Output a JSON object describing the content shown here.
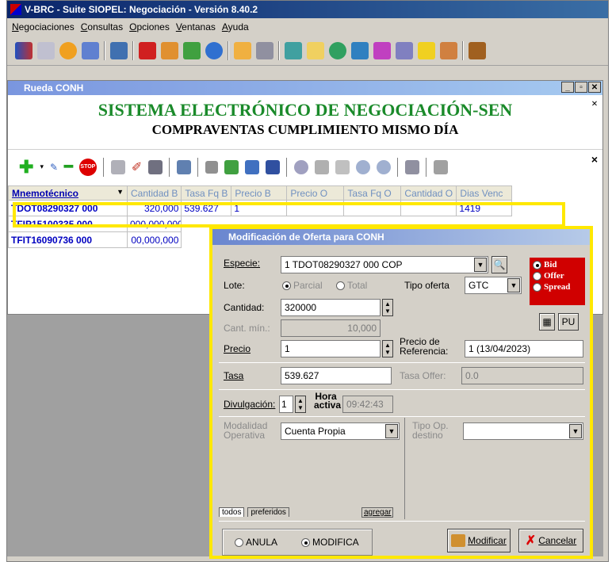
{
  "app": {
    "title": "V-BRC - Suite SIOPEL: Negociación - Versión 8.40.2"
  },
  "menu": [
    "Negociaciones",
    "Consultas",
    "Opciones",
    "Ventanas",
    "Ayuda"
  ],
  "subwindow": {
    "title": "Rueda CONH",
    "banner_line1": "SISTEMA ELECTRÓNICO DE NEGOCIACIÓN-SEN",
    "banner_line2": "COMPRAVENTAS CUMPLIMIENTO MISMO DÍA"
  },
  "grid": {
    "columns": [
      "Mnemotécnico",
      "Cantidad B",
      "Tasa Fq B",
      "Precio B",
      "Precio O",
      "Tasa Fq O",
      "Cantidad O",
      "Dias Venc"
    ],
    "rows": [
      {
        "mnemo": "TDOT08290327 000",
        "cant_b": "320,000",
        "tasa_b": "539.627",
        "precio_b": "1",
        "precio_o": "",
        "tasa_o": "",
        "cant_o": "",
        "dias": "1419"
      },
      {
        "mnemo": "TFIP15100335 000",
        "cant_b": "000,000,000",
        "tasa_b": "",
        "precio_b": "",
        "precio_o": "",
        "tasa_o": "",
        "cant_o": "",
        "dias": ""
      },
      {
        "mnemo": "TFIT16090736 000",
        "cant_b": "00,000,000",
        "tasa_b": "",
        "precio_b": "",
        "precio_o": "",
        "tasa_o": "",
        "cant_o": "",
        "dias": ""
      }
    ]
  },
  "dialog": {
    "title": "Modificación de Oferta para CONH",
    "especie_label": "Especie:",
    "especie_value": "1 TDOT08290327 000 COP",
    "lote_label": "Lote:",
    "lote_parcial": "Parcial",
    "lote_total": "Total",
    "tipo_oferta_label": "Tipo oferta",
    "tipo_oferta_value": "GTC",
    "bid": "Bid",
    "offer": "Offer",
    "spread": "Spread",
    "cantidad_label": "Cantidad:",
    "cantidad_value": "320000",
    "cant_min_label": "Cant. mín.:",
    "cant_min_value": "10,000",
    "pu_label": "PU",
    "precio_label": "Precio",
    "precio_value": "1",
    "precio_ref_label": "Precio de Referencia:",
    "precio_ref_value": "1 (13/04/2023)",
    "tasa_label": "Tasa",
    "tasa_value": "539.627",
    "tasa_offer_label": "Tasa Offer:",
    "tasa_offer_value": "0.0",
    "divulgacion_label": "Divulgación:",
    "divulgacion_value": "1",
    "hora_activa_label": "Hora activa",
    "hora_activa_value": "09:42:43",
    "modalidad_label": "Modalidad Operativa",
    "modalidad_value": "Cuenta Propia",
    "tipo_op_label": "Tipo Op. destino",
    "tipo_op_value": "",
    "tab_todos": "todos",
    "tab_preferidos": "preferidos",
    "agregar": "agregar",
    "anula": "ANULA",
    "modifica": "MODIFICA",
    "btn_modificar": "Modificar",
    "btn_cancelar": "Cancelar"
  },
  "colors": {
    "highlight": "#ffe800",
    "banner_green": "#1a8a2a",
    "bid_red": "#d00000"
  }
}
